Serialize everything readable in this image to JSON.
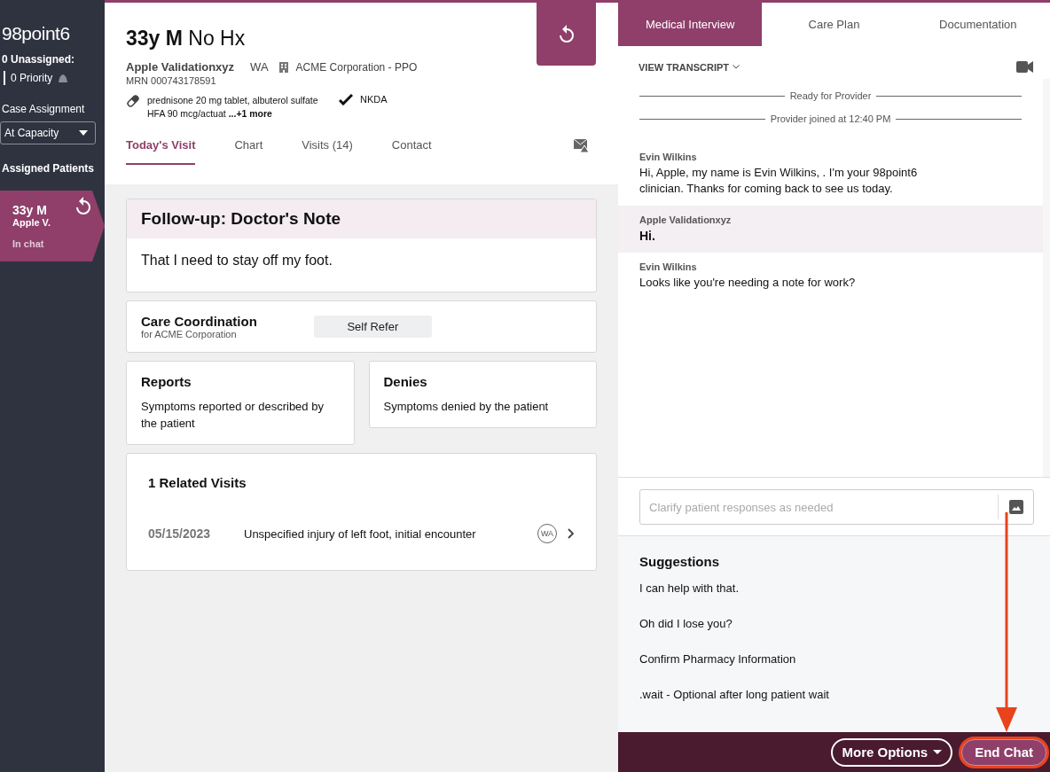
{
  "sidebar": {
    "logo": "98point6",
    "unassigned": "0 Unassigned:",
    "priority": "0 Priority",
    "case_assignment_label": "Case Assignment",
    "case_assignment": "At Capacity",
    "assigned_label": "Assigned Patients",
    "patients": [
      {
        "title": "33y M",
        "name": "Apple V.",
        "status": "In chat",
        "selected": true
      }
    ]
  },
  "patient": {
    "age_sex": "33y M",
    "history": "No Hx",
    "name": "Apple Validationxyz",
    "state": "WA",
    "insurance": "ACME Corporation - PPO",
    "mrn": "MRN 000743178591",
    "medications": "prednisone 20 mg tablet, albuterol sulfate HFA 90 mcg/actuat",
    "more": "...+1 more",
    "allergies": "NKDA"
  },
  "tabs": [
    {
      "label": "Today's Visit",
      "selected": true
    },
    {
      "label": "Chart",
      "selected": false
    },
    {
      "label": "Visits (14)",
      "selected": false
    },
    {
      "label": "Contact",
      "selected": false
    }
  ],
  "visit": {
    "reason_title": "Follow-up: Doctor's Note",
    "reason": "That I need to stay off my foot.",
    "care_title": "Care Coordination",
    "care_sub": "for ACME Corporation",
    "care_button": "Self Refer",
    "reports_title": "Reports",
    "reports_text": "Symptoms reported or described by the patient",
    "denies_title": "Denies",
    "denies_text": "Symptoms denied by the patient",
    "related_title": "1 Related Visits",
    "related": [
      {
        "date": "05/15/2023",
        "diagnosis": "Unspecified injury of left foot, initial encounter",
        "state": "WA"
      }
    ]
  },
  "panel_tabs": [
    {
      "label": "Medical Interview",
      "selected": true
    },
    {
      "label": "Care Plan",
      "selected": false
    },
    {
      "label": "Documentation",
      "selected": false
    }
  ],
  "transcript": {
    "toggle": "VIEW TRANSCRIPT",
    "events": [
      "Ready for Provider",
      "Provider joined at 12:40 PM"
    ],
    "messages": [
      {
        "sender": "Evin Wilkins",
        "text": "Hi, Apple, my name is Evin Wilkins, . I'm your 98point6 clinician. Thanks for coming back to see us today.",
        "from_patient": false
      },
      {
        "sender": "Apple Validationxyz",
        "text": "Hi.",
        "from_patient": true
      },
      {
        "sender": "Evin Wilkins",
        "text": "Looks like you're needing a note for work?",
        "from_patient": false
      }
    ]
  },
  "composer": {
    "placeholder": "Clarify patient responses as needed"
  },
  "suggestions": {
    "title": "Suggestions",
    "items": [
      "I can help with that.",
      "Oh did I lose you?",
      "Confirm Pharmacy Information",
      ".wait - Optional after long patient wait"
    ]
  },
  "footer": {
    "more_options": "More Options",
    "end_chat": "End Chat",
    "end_chat_highlighted": true
  }
}
